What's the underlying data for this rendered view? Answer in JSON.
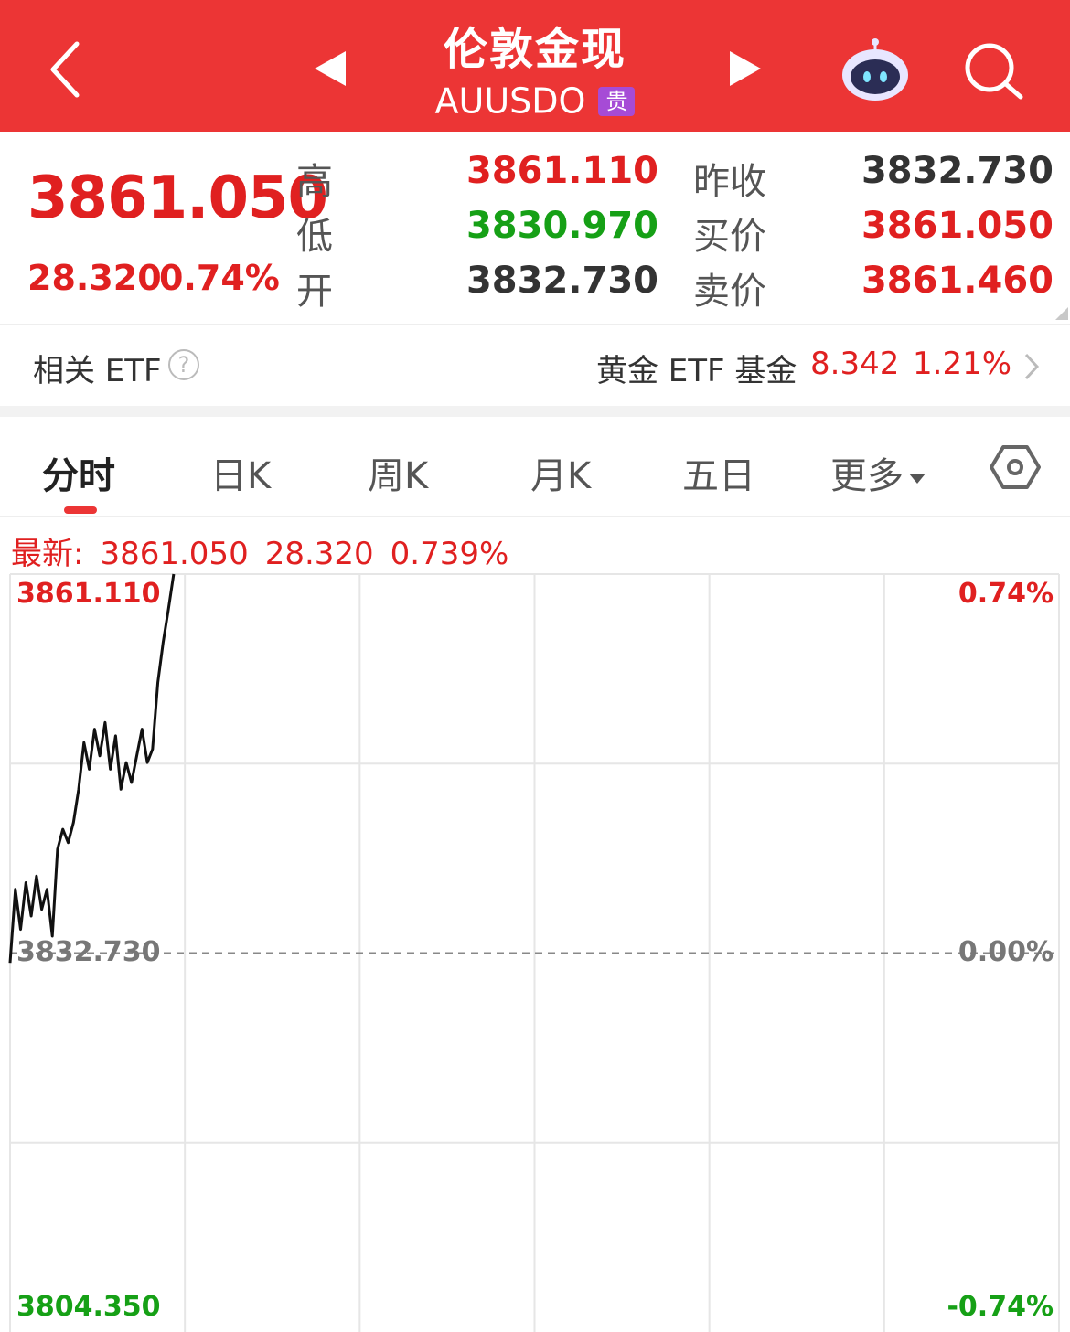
{
  "header": {
    "title": "伦敦金现",
    "code": "AUUSDO",
    "badge": "贵",
    "icons": [
      "chevron-left-icon",
      "triangle-left-icon",
      "triangle-right-icon",
      "robot-icon",
      "search-icon"
    ]
  },
  "quote": {
    "last": "3861.050",
    "change": "28.320",
    "change_pct": "0.74%",
    "high_label": "高",
    "high": "3861.110",
    "low_label": "低",
    "low": "3830.970",
    "open_label": "开",
    "open": "3832.730",
    "prev_close_label": "昨收",
    "prev_close": "3832.730",
    "bid_label": "买价",
    "bid": "3861.050",
    "ask_label": "卖价",
    "ask": "3861.460"
  },
  "etf": {
    "label": "相关 ETF",
    "help": "?",
    "name": "黄金 ETF 基金",
    "price": "8.342",
    "pct": "1.21%"
  },
  "tabs": [
    {
      "label": "分时",
      "active": true
    },
    {
      "label": "日K",
      "active": false
    },
    {
      "label": "周K",
      "active": false
    },
    {
      "label": "月K",
      "active": false
    },
    {
      "label": "五日",
      "active": false
    },
    {
      "label": "更多",
      "active": false
    }
  ],
  "latest_line": {
    "prefix": "最新:",
    "price": "3861.050",
    "change": "28.320",
    "pct": "0.739%"
  },
  "colors": {
    "brand_red": "#ec3535",
    "up": "#e02020",
    "down": "#16a016",
    "badge_purple": "#a64bd6"
  },
  "chart_data": {
    "type": "line",
    "y_top_label": "3861.110",
    "y_mid_label": "3832.730",
    "y_bottom_label": "3804.350",
    "pct_top_label": "0.74%",
    "pct_mid_label": "0.00%",
    "pct_bottom_label": "-0.74%",
    "ylim": [
      3804.35,
      3861.11
    ],
    "reference": 3832.73,
    "x_fraction_range": [
      0,
      0.156
    ],
    "series": [
      {
        "values": [
          3832.0,
          3837.5,
          3834.5,
          3838.0,
          3835.5,
          3838.5,
          3836.0,
          3837.5,
          3834.0,
          3840.5,
          3842.0,
          3841.0,
          3842.5,
          3845.0,
          3848.5,
          3846.5,
          3849.5,
          3847.5,
          3850.0,
          3846.5,
          3849.0,
          3845.0,
          3847.0,
          3845.5,
          3847.5,
          3849.5,
          3847.0,
          3848.0,
          3853.0,
          3856.0,
          3858.5,
          3861.11
        ]
      }
    ]
  }
}
